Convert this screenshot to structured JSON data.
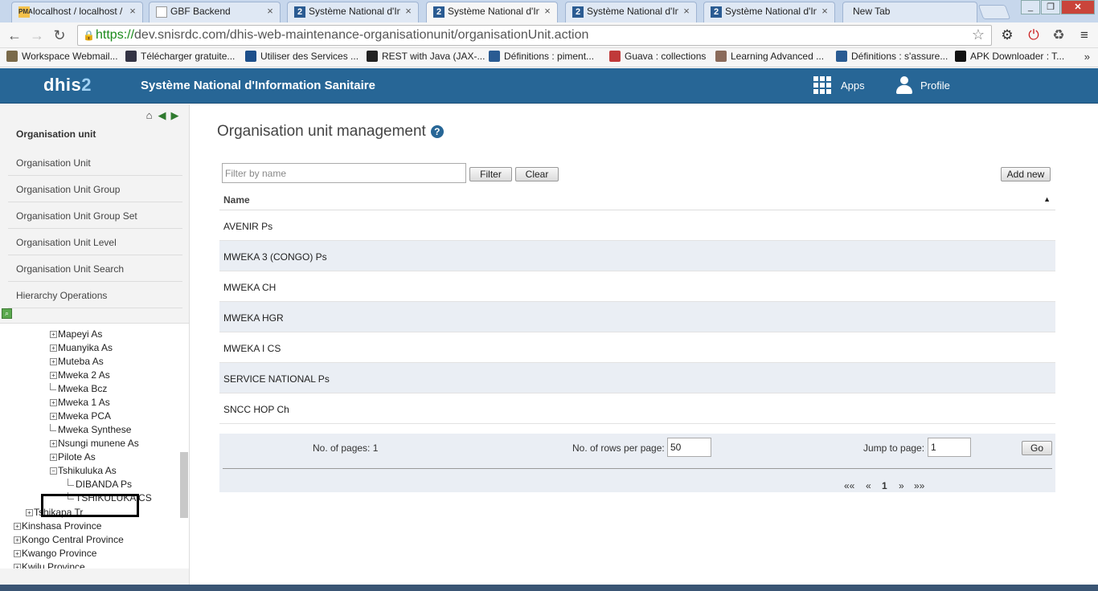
{
  "browser": {
    "tabs": [
      {
        "title": "localhost / localhost /",
        "icon": "phpmyadmin-icon",
        "active": false
      },
      {
        "title": "GBF Backend",
        "icon": "document-icon",
        "active": false
      },
      {
        "title": "Système National d'Inf",
        "icon": "dhis2-icon",
        "active": false
      },
      {
        "title": "Système National d'Inf",
        "icon": "dhis2-icon",
        "active": true
      },
      {
        "title": "Système National d'Inf",
        "icon": "dhis2-icon",
        "active": false
      },
      {
        "title": "Système National d'Inf",
        "icon": "dhis2-icon",
        "active": false
      },
      {
        "title": "New Tab",
        "icon": "none",
        "active": false
      }
    ],
    "url_scheme": "https://",
    "url_rest": "dev.snisrdc.com/dhis-web-maintenance-organisationunit/organisationUnit.action",
    "bookmarks": [
      "Workspace Webmail...",
      "Télécharger gratuite...",
      "Utiliser des Services ...",
      "REST with Java (JAX-...",
      "Définitions : piment...",
      "Guava : collections",
      "Learning Advanced ...",
      "Définitions : s'assure...",
      "APK Downloader : T..."
    ],
    "bookmarks_overflow": "»"
  },
  "header": {
    "logo_main": "dhis",
    "logo_num": "2",
    "title": "Système National d'Information Sanitaire",
    "apps_label": "Apps",
    "profile_label": "Profile",
    "accent": "#276696"
  },
  "sidebar": {
    "heading": "Organisation unit",
    "items": [
      "Organisation Unit",
      "Organisation Unit Group",
      "Organisation Unit Group Set",
      "Organisation Unit Level",
      "Organisation Unit Search",
      "Hierarchy Operations"
    ]
  },
  "tree": [
    {
      "label": "Mapeyi As",
      "toggle": "+"
    },
    {
      "label": "Muanyika As",
      "toggle": "+"
    },
    {
      "label": "Muteba As",
      "toggle": "+"
    },
    {
      "label": "Mweka 2 As",
      "toggle": "+"
    },
    {
      "label": "Mweka Bcz",
      "toggle": ""
    },
    {
      "label": "Mweka 1 As",
      "toggle": "+"
    },
    {
      "label": "Mweka PCA",
      "toggle": "+"
    },
    {
      "label": "Mweka Synthese",
      "toggle": ""
    },
    {
      "label": "Nsungi munene As",
      "toggle": "+"
    },
    {
      "label": "Pilote As",
      "toggle": "+"
    },
    {
      "label": "Tshikuluka As",
      "toggle": "-"
    },
    {
      "label": "DIBANDA Ps",
      "toggle": ""
    },
    {
      "label": "TSHIKULUKA CS",
      "toggle": ""
    },
    {
      "label": "Tshikapa Tr",
      "toggle": "+"
    },
    {
      "label": "Kinshasa Province",
      "toggle": "+"
    },
    {
      "label": "Kongo Central Province",
      "toggle": "+"
    },
    {
      "label": "Kwango Province",
      "toggle": "+"
    },
    {
      "label": "Kwilu Province",
      "toggle": "+"
    }
  ],
  "main": {
    "title": "Organisation unit management",
    "filter_placeholder": "Filter by name",
    "filter_btn": "Filter",
    "clear_btn": "Clear",
    "add_btn": "Add new",
    "col_name": "Name",
    "rows": [
      "AVENIR Ps",
      "MWEKA 3 (CONGO) Ps",
      "MWEKA CH",
      "MWEKA HGR",
      "MWEKA I CS",
      "SERVICE NATIONAL Ps",
      "SNCC HOP Ch"
    ]
  },
  "pager": {
    "pages_label": "No. of pages: 1",
    "rows_label": "No. of rows per page:",
    "rows_value": "50",
    "jump_label": "Jump to page:",
    "jump_value": "1",
    "go_btn": "Go",
    "first": "««",
    "prev": "«",
    "current": "1",
    "next": "»",
    "last": "»»"
  }
}
